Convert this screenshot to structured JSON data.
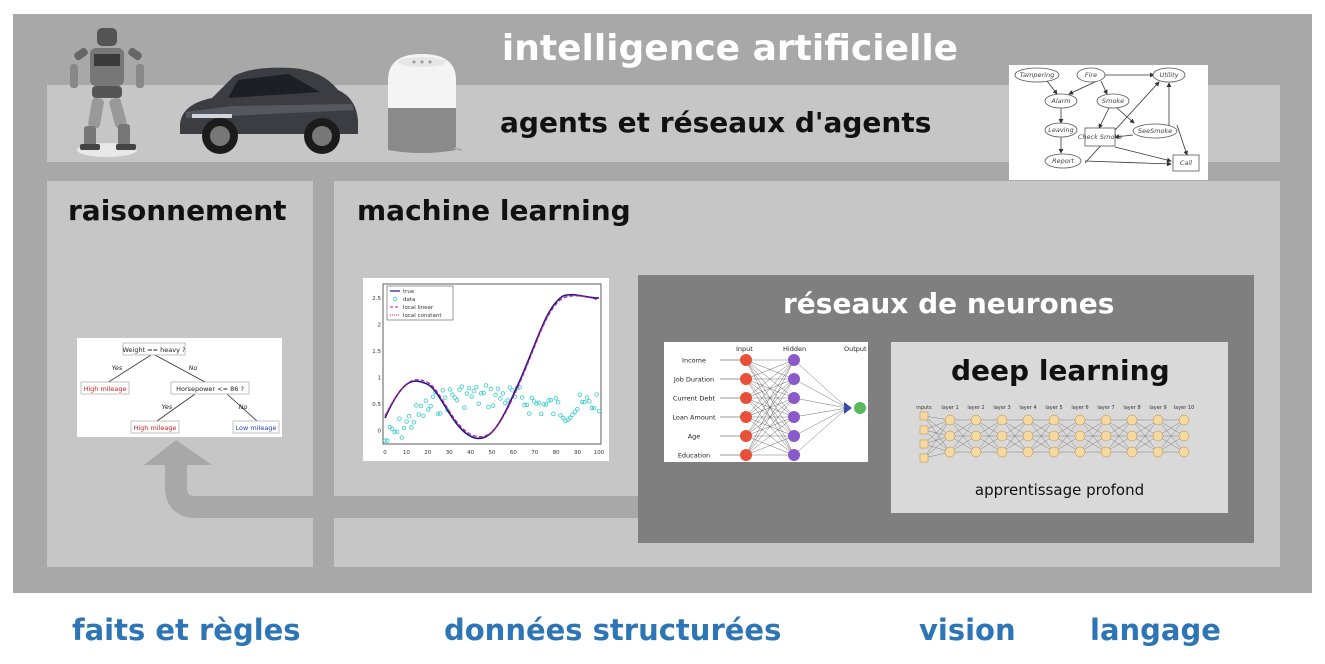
{
  "titles": {
    "ai": "intelligence artificielle",
    "agents": "agents et réseaux d'agents",
    "reasoning": "raisonnement",
    "ml": "machine learning",
    "nn": "réseaux de neurones",
    "dl": "deep learning",
    "dl_sub": "apprentissage profond"
  },
  "bottom_labels": {
    "facts": "faits et règles",
    "structured": "données structurées",
    "vision": "vision",
    "language": "langage"
  },
  "bayes_net": {
    "nodes": [
      "Tampering",
      "Fire",
      "Utility",
      "Alarm",
      "Smoke",
      "Leaving",
      "Check Smoke",
      "SeeSmoke",
      "Report",
      "Call"
    ]
  },
  "decision_tree": {
    "root": "Weight == heavy ?",
    "yes1": "Yes",
    "no1": "No",
    "leaf_high1": "High mileage",
    "node2": "Horsepower <= 86 ?",
    "yes2": "Yes",
    "no2": "No",
    "leaf_high2": "High mileage",
    "leaf_low": "Low mileage"
  },
  "regression_plot": {
    "legend": [
      "true",
      "data",
      "local linear",
      "local constant"
    ],
    "yticks": [
      "2.5",
      "2",
      "1.5",
      "1",
      "0.5",
      "0"
    ],
    "xticks": [
      "0",
      "10",
      "20",
      "30",
      "40",
      "50",
      "60",
      "70",
      "80",
      "90",
      "100"
    ]
  },
  "nn_diagram": {
    "col_input": "Input",
    "col_hidden": "Hidden",
    "col_output": "Output",
    "inputs": [
      "Income",
      "Job Duration",
      "Current Debt",
      "Loan Amount",
      "Age",
      "Education"
    ]
  },
  "deep_net": {
    "inputs_label": "inputs",
    "layers": [
      "layer 1",
      "layer 2",
      "layer 3",
      "layer 4",
      "layer 5",
      "layer 6",
      "layer 7",
      "layer 8",
      "layer 9",
      "layer 10"
    ]
  },
  "colors": {
    "outer": "#a8a8a8",
    "panel": "#c6c6c6",
    "nn_box": "#7f7f7f",
    "dl_box": "#d9d9d9",
    "bottom_text": "#2e75b6"
  }
}
